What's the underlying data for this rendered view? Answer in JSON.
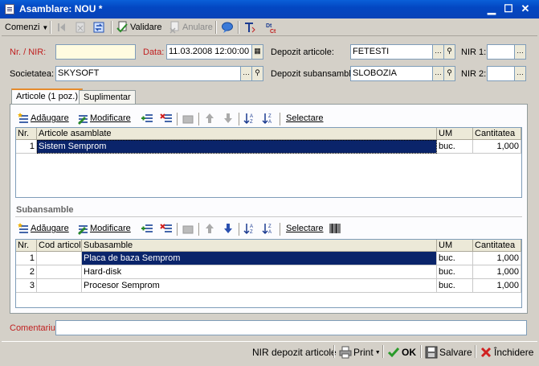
{
  "window": {
    "title": "Asamblare: NOU *"
  },
  "toolbar": {
    "comenzi": "Comenzi",
    "validare": "Validare",
    "anulare": "Anulare"
  },
  "form": {
    "nr_nir_label": "Nr. / NIR:",
    "nr_nir_value": "",
    "data_label": "Data:",
    "data_value": "11.03.2008 12:00:00",
    "depozit_articole_label": "Depozit articole:",
    "depozit_articole_value": "FETESTI",
    "nir1_label": "NIR 1:",
    "nir1_value": "",
    "societatea_label": "Societatea:",
    "societatea_value": "SKYSOFT",
    "depozit_subansamble_label": "Depozit subansamble:",
    "depozit_subansamble_value": "SLOBOZIA",
    "nir2_label": "NIR 2:",
    "nir2_value": ""
  },
  "tabs": [
    {
      "label": "Articole (1 poz.)"
    },
    {
      "label": "Suplimentar"
    }
  ],
  "articole_toolbar": {
    "adaugare": "Adăugare",
    "modificare": "Modificare",
    "selectare": "Selectare"
  },
  "articole_grid": {
    "columns": [
      "Nr.",
      "Articole asamblate",
      "UM",
      "Cantitatea"
    ],
    "rows": [
      {
        "nr": "1",
        "articol": "Sistem Semprom",
        "um": "buc.",
        "cantitate": "1,000"
      }
    ]
  },
  "subansamble": {
    "title": "Subansamble",
    "adaugare": "Adăugare",
    "modificare": "Modificare",
    "selectare": "Selectare",
    "columns": [
      "Nr.",
      "Cod articol",
      "Subasamble",
      "UM",
      "Cantitatea"
    ],
    "rows": [
      {
        "nr": "1",
        "cod": "",
        "name": "Placa de baza Semprom",
        "um": "buc.",
        "cantitate": "1,000"
      },
      {
        "nr": "2",
        "cod": "",
        "name": "Hard-disk",
        "um": "buc.",
        "cantitate": "1,000"
      },
      {
        "nr": "3",
        "cod": "",
        "name": "Procesor Semprom",
        "um": "buc.",
        "cantitate": "1,000"
      }
    ]
  },
  "comentariu": {
    "label": "Comentariu:",
    "value": ""
  },
  "statusbar": {
    "nir_depozit": "NIR depozit articole",
    "print": "Print",
    "ok": "OK",
    "salvare": "Salvare",
    "inchidere": "Închidere"
  },
  "colors": {
    "title_blue": "#0347c2",
    "selection": "#0a246a",
    "required_label": "#c02020"
  }
}
